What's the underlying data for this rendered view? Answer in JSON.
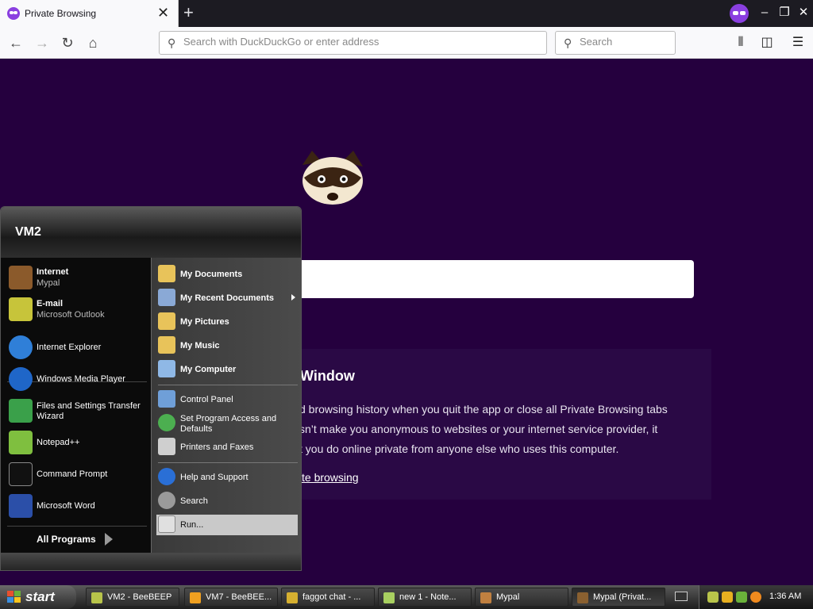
{
  "browser": {
    "tab_title": "Private Browsing",
    "tab_close": "✕",
    "new_tab": "+",
    "window_controls": {
      "minimize": "‒",
      "restore": "❐",
      "close": "✕"
    },
    "nav": {
      "back": "←",
      "forward": "→",
      "reload": "↻",
      "home": "⌂"
    },
    "url_placeholder": "Search with DuckDuckGo or enter address",
    "search_placeholder": "Search",
    "toolbar": {
      "library": "⫴",
      "sidebar": "◫",
      "menu": "☰"
    }
  },
  "private_page": {
    "heading": "Window",
    "lines": [
      "d browsing history when you quit the app or close all Private Browsing tabs",
      "sn’t make you anonymous to websites or your internet service provider, it",
      "t you do online private from anyone else who uses this computer."
    ],
    "link": "te browsing"
  },
  "start_menu": {
    "user": "VM2",
    "pinned": [
      {
        "label": "Internet",
        "sub": "Mypal",
        "icon": "raccoon-icon",
        "color": "#8b5a2b"
      },
      {
        "label": "E-mail",
        "sub": "Microsoft Outlook",
        "icon": "outlook-icon",
        "color": "#c7c43a"
      }
    ],
    "recent": [
      {
        "label": "Internet Explorer",
        "icon": "internet-explorer-icon",
        "color": "#2f7fd8"
      },
      {
        "label": "Windows Media Player",
        "icon": "media-player-icon",
        "color": "#1f66c8"
      },
      {
        "label": "Files and Settings Transfer Wizard",
        "icon": "transfer-wizard-icon",
        "color": "#3aa04a"
      },
      {
        "label": "Notepad++",
        "icon": "notepad-plus-plus-icon",
        "color": "#7fbf3f"
      },
      {
        "label": "Command Prompt",
        "icon": "command-prompt-icon",
        "color": "#111111"
      },
      {
        "label": "Microsoft Word",
        "icon": "word-icon",
        "color": "#2b4fa8"
      }
    ],
    "all_programs": "All Programs",
    "places": [
      {
        "label": "My Documents",
        "icon": "my-documents-icon",
        "color": "#e8c35a"
      },
      {
        "label": "My Recent Documents",
        "icon": "recent-documents-icon",
        "color": "#8aa9d6"
      },
      {
        "label": "My Pictures",
        "icon": "my-pictures-icon",
        "color": "#e8c35a"
      },
      {
        "label": "My Music",
        "icon": "my-music-icon",
        "color": "#e8c35a"
      },
      {
        "label": "My Computer",
        "icon": "my-computer-icon",
        "color": "#8fb8e6"
      }
    ],
    "settings": [
      {
        "label": "Control Panel",
        "icon": "control-panel-icon",
        "color": "#6f9fd8"
      },
      {
        "label": "Set Program Access and Defaults",
        "icon": "program-access-icon",
        "color": "#4caf50"
      },
      {
        "label": "Printers and Faxes",
        "icon": "printer-icon",
        "color": "#cfcfcf"
      }
    ],
    "help": [
      {
        "label": "Help and Support",
        "icon": "help-icon",
        "color": "#2a6fd6"
      },
      {
        "label": "Search",
        "icon": "search-icon",
        "color": "#9a9a9a"
      },
      {
        "label": "Run...",
        "icon": "run-icon",
        "color": "#e0e0e0"
      }
    ]
  },
  "taskbar": {
    "start": "start",
    "buttons": [
      {
        "label": "VM2 - BeeBEEP",
        "icon": "beebeep-icon",
        "color": "#b8c44a"
      },
      {
        "label": "VM7 - BeeBEE...",
        "icon": "vmware-icon",
        "color": "#f0a020"
      },
      {
        "label": "faggot chat - ...",
        "icon": "chat-icon",
        "color": "#d6b030"
      },
      {
        "label": "new 1 - Note...",
        "icon": "notepad-icon",
        "color": "#a8d060"
      },
      {
        "label": "Mypal",
        "icon": "mypal-icon",
        "color": "#c08040"
      },
      {
        "label": "Mypal (Privat...",
        "icon": "mypal-private-icon",
        "color": "#8a6030"
      }
    ],
    "clock": "1:36 AM"
  }
}
